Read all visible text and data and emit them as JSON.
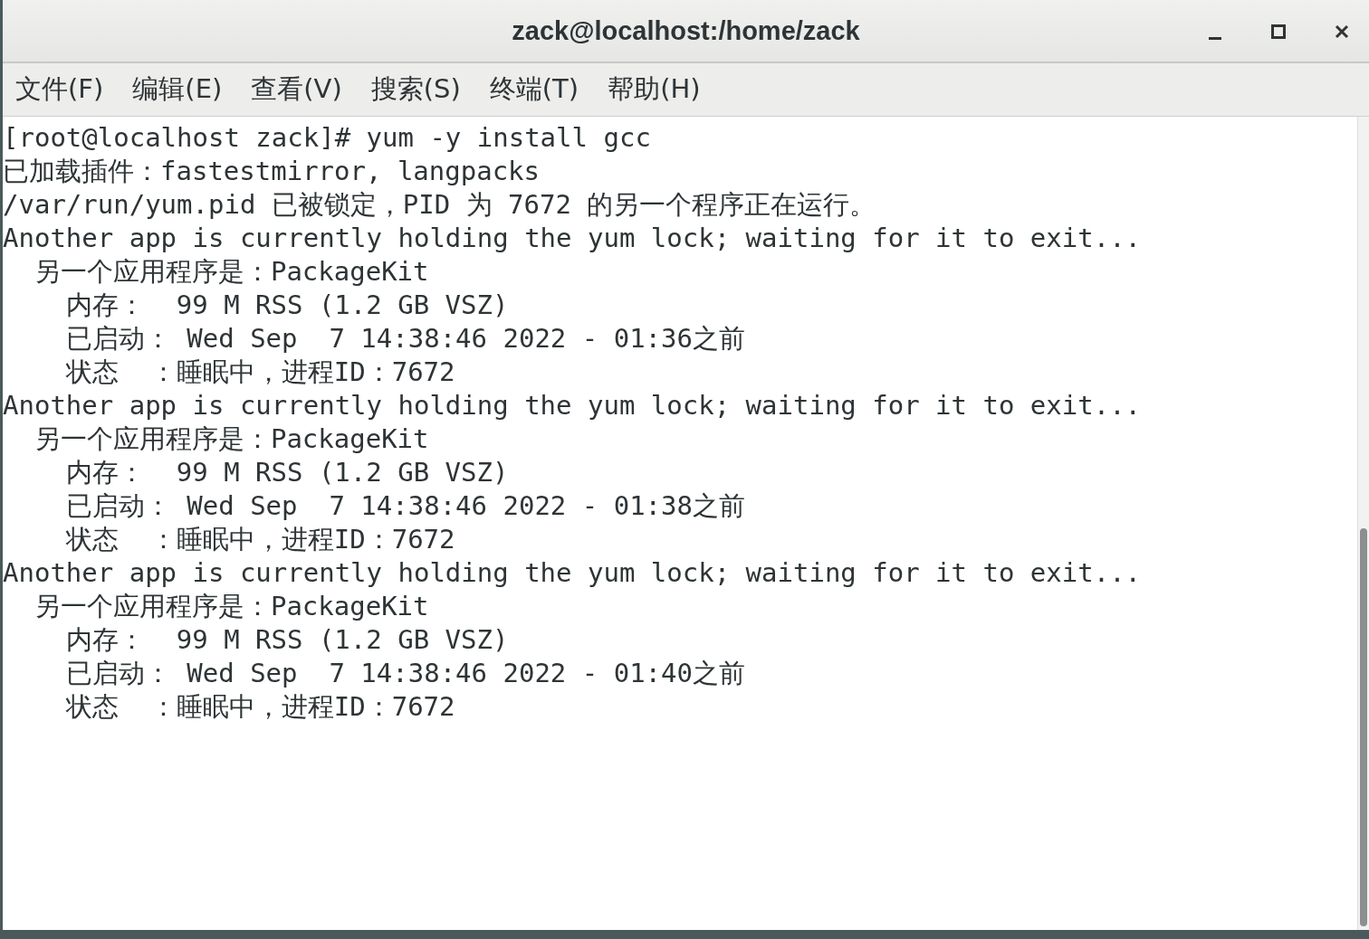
{
  "window": {
    "title": "zack@localhost:/home/zack"
  },
  "menu": [
    "文件(F)",
    "编辑(E)",
    "查看(V)",
    "搜索(S)",
    "终端(T)",
    "帮助(H)"
  ],
  "terminal": {
    "lines": [
      "[root@localhost zack]# yum -y install gcc",
      "已加载插件：fastestmirror, langpacks",
      "/var/run/yum.pid 已被锁定，PID 为 7672 的另一个程序正在运行。",
      "Another app is currently holding the yum lock; waiting for it to exit...",
      "  另一个应用程序是：PackageKit",
      "    内存：  99 M RSS (1.2 GB VSZ)",
      "    已启动： Wed Sep  7 14:38:46 2022 - 01:36之前",
      "    状态  ：睡眠中，进程ID：7672",
      "Another app is currently holding the yum lock; waiting for it to exit...",
      "  另一个应用程序是：PackageKit",
      "    内存：  99 M RSS (1.2 GB VSZ)",
      "    已启动： Wed Sep  7 14:38:46 2022 - 01:38之前",
      "    状态  ：睡眠中，进程ID：7672",
      "Another app is currently holding the yum lock; waiting for it to exit...",
      "  另一个应用程序是：PackageKit",
      "    内存：  99 M RSS (1.2 GB VSZ)",
      "    已启动： Wed Sep  7 14:38:46 2022 - 01:40之前",
      "    状态  ：睡眠中，进程ID：7672"
    ]
  }
}
